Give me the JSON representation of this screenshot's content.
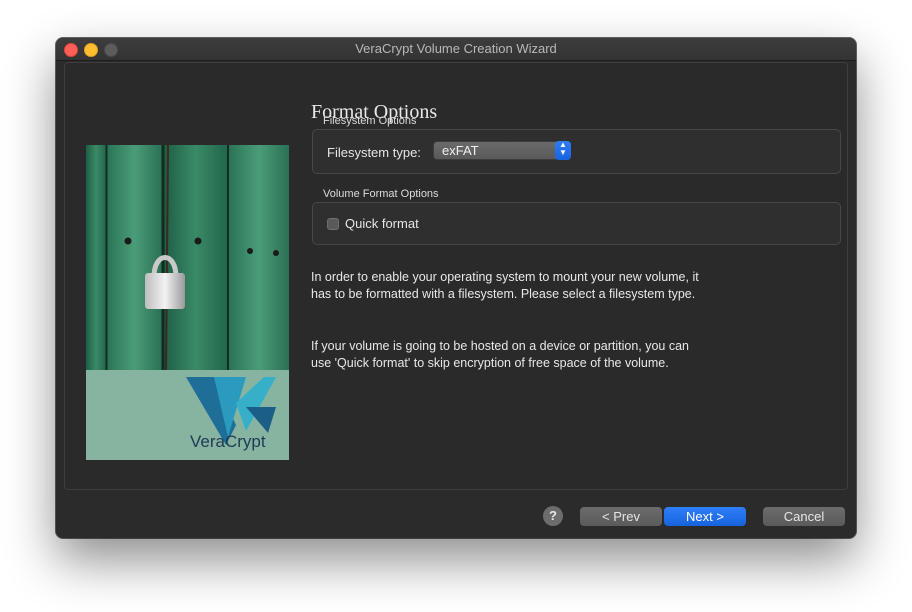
{
  "window": {
    "title": "VeraCrypt Volume Creation Wizard"
  },
  "sidebar_image": {
    "alt": "VeraCrypt",
    "logo_text": "VeraCrypt"
  },
  "page": {
    "title": "Format Options"
  },
  "filesystem_options": {
    "group_label": "Filesystem Options",
    "type_label": "Filesystem type:",
    "selected_type": "exFAT"
  },
  "volume_format_options": {
    "group_label": "Volume Format Options",
    "quick_format_label": "Quick format",
    "quick_format_checked": false
  },
  "description": {
    "paragraph1": "In order to enable your operating system to mount your new volume, it has to be formatted with a filesystem. Please select a filesystem type.",
    "paragraph2": "If your volume is going to be hosted on a device or partition, you can use 'Quick format' to skip encryption of free space of the volume."
  },
  "buttons": {
    "help": "?",
    "prev": "< Prev",
    "next": "Next >",
    "cancel": "Cancel"
  },
  "colors": {
    "accent": "#1a6ae8",
    "window_bg": "#2b2b2b"
  }
}
